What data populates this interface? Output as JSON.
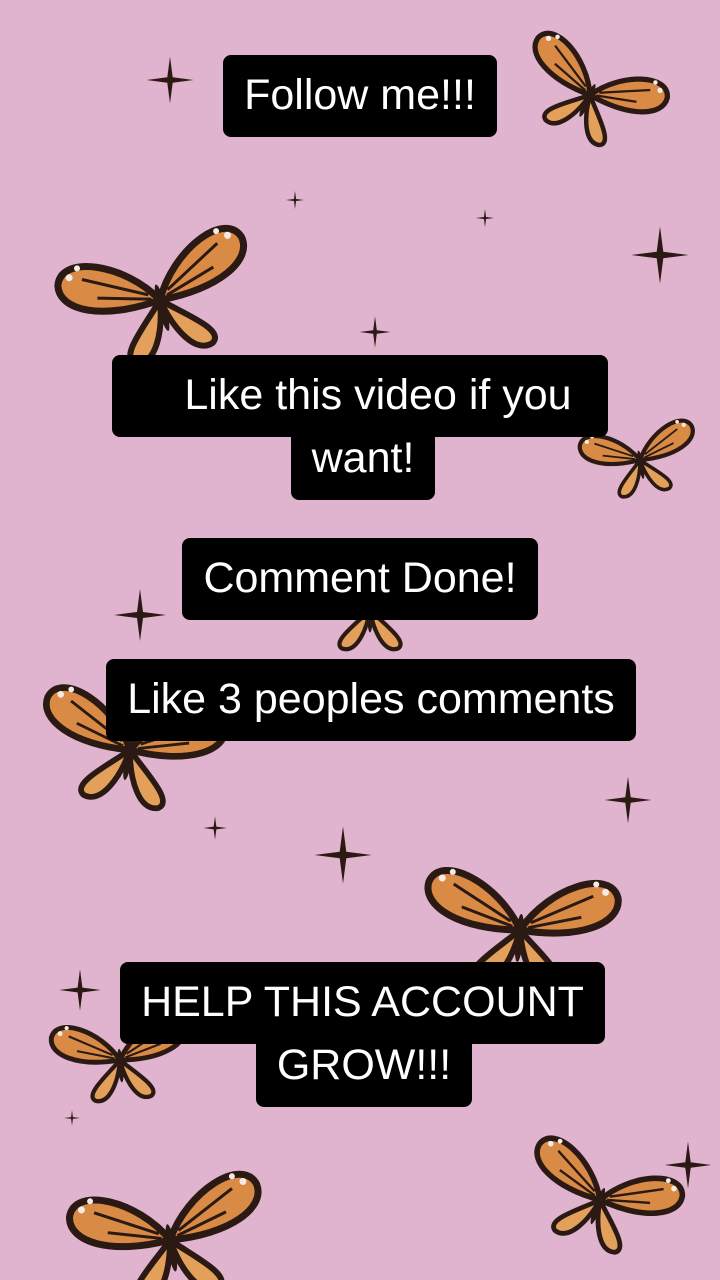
{
  "background_color": "#e0b3ce",
  "butterfly_colors": {
    "wing": "#d98a45",
    "vein": "#2b1a14",
    "spot": "#f3ece6"
  },
  "background_decorations": {
    "icons": [
      "butterfly-icon",
      "sparkle-icon"
    ]
  },
  "captions": {
    "follow": "Follow me!!!",
    "like_line1": "Like this video if you",
    "like_line2": "want!",
    "comment": "Comment Done!",
    "like_comments": "Like 3 peoples comments",
    "help_line1": "HELP THIS ACCOUNT",
    "help_line2": "GROW!!!"
  }
}
